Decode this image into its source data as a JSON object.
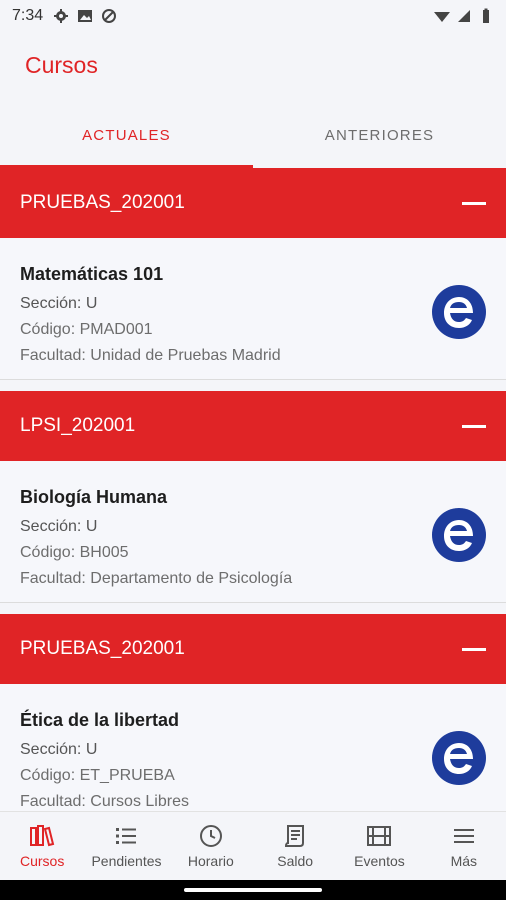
{
  "status_bar": {
    "time": "7:34",
    "icons_left": [
      "gear-icon",
      "image-icon",
      "no-signal-icon"
    ],
    "icons_right": [
      "wifi-icon",
      "cellular-icon",
      "battery-icon"
    ]
  },
  "header": {
    "title": "Cursos"
  },
  "tabs": [
    {
      "label": "ACTUALES",
      "active": true
    },
    {
      "label": "ANTERIORES",
      "active": false
    }
  ],
  "groups": [
    {
      "name": "PRUEBAS_202001",
      "course": {
        "name": "Matemáticas 101",
        "section": "Sección: U",
        "code": "Código: PMAD001",
        "faculty": "Facultad: Unidad de Pruebas Madrid"
      }
    },
    {
      "name": "LPSI_202001",
      "course": {
        "name": "Biología Humana",
        "section": "Sección: U",
        "code": "Código: BH005",
        "faculty": "Facultad: Departamento de Psicología"
      }
    },
    {
      "name": "PRUEBAS_202001",
      "course": {
        "name": "Ética de la libertad",
        "section": "Sección: U",
        "code": "Código: ET_PRUEBA",
        "faculty": "Facultad: Cursos Libres"
      }
    }
  ],
  "bottom_nav": [
    {
      "label": "Cursos",
      "icon": "books-icon",
      "active": true
    },
    {
      "label": "Pendientes",
      "icon": "list-icon",
      "active": false
    },
    {
      "label": "Horario",
      "icon": "clock-icon",
      "active": false
    },
    {
      "label": "Saldo",
      "icon": "receipt-icon",
      "active": false
    },
    {
      "label": "Eventos",
      "icon": "film-icon",
      "active": false
    },
    {
      "label": "Más",
      "icon": "menu-icon",
      "active": false
    }
  ],
  "colors": {
    "accent": "#e02426",
    "logo_blue": "#1e3c9c"
  }
}
